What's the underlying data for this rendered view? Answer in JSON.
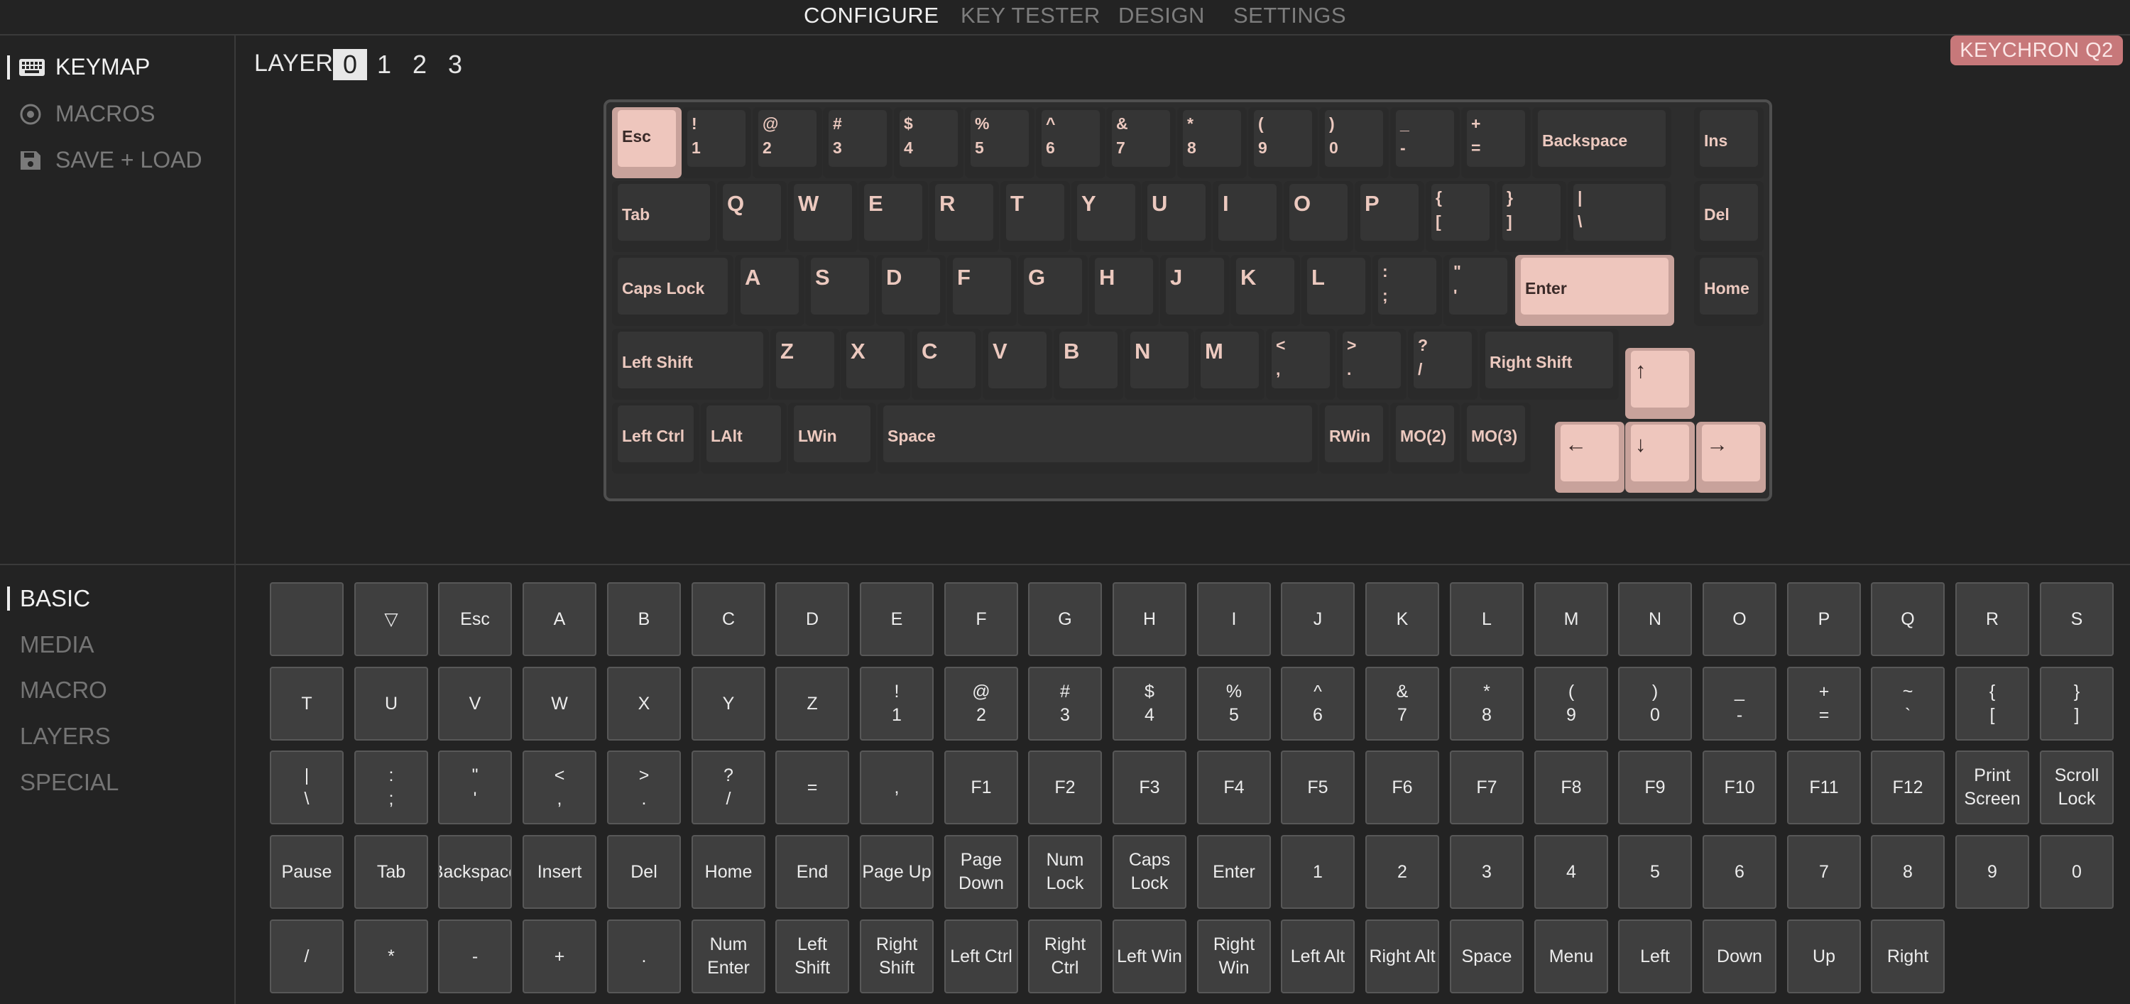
{
  "nav": {
    "tabs": [
      "CONFIGURE",
      "KEY TESTER",
      "DESIGN",
      "SETTINGS"
    ]
  },
  "sidebar": {
    "items": [
      "KEYMAP",
      "MACROS",
      "SAVE + LOAD"
    ]
  },
  "layer": {
    "label": "LAYER",
    "options": [
      "0",
      "1",
      "2",
      "3"
    ],
    "selected": "0"
  },
  "device": {
    "name": "KEYCHRON Q2"
  },
  "colors": {
    "accent": "#eec6bd",
    "badge": "#c7787a",
    "background": "#232323"
  },
  "keyboard": {
    "rows": [
      [
        {
          "main": "Esc",
          "accent": true
        },
        {
          "up": "!",
          "lo": "1"
        },
        {
          "up": "@",
          "lo": "2"
        },
        {
          "up": "#",
          "lo": "3"
        },
        {
          "up": "$",
          "lo": "4"
        },
        {
          "up": "%",
          "lo": "5"
        },
        {
          "up": "^",
          "lo": "6"
        },
        {
          "up": "&",
          "lo": "7"
        },
        {
          "up": "*",
          "lo": "8"
        },
        {
          "up": "(",
          "lo": "9"
        },
        {
          "up": ")",
          "lo": "0"
        },
        {
          "up": "_",
          "lo": "-"
        },
        {
          "up": "+",
          "lo": "="
        },
        {
          "main": "Backspace"
        },
        {
          "main": "Ins"
        }
      ],
      [
        {
          "main": "Tab"
        },
        {
          "main": "Q"
        },
        {
          "main": "W"
        },
        {
          "main": "E"
        },
        {
          "main": "R"
        },
        {
          "main": "T"
        },
        {
          "main": "Y"
        },
        {
          "main": "U"
        },
        {
          "main": "I"
        },
        {
          "main": "O"
        },
        {
          "main": "P"
        },
        {
          "up": "{",
          "lo": "["
        },
        {
          "up": "}",
          "lo": "]"
        },
        {
          "up": "|",
          "lo": "\\"
        },
        {
          "main": "Del"
        }
      ],
      [
        {
          "main": "Caps Lock"
        },
        {
          "main": "A"
        },
        {
          "main": "S"
        },
        {
          "main": "D"
        },
        {
          "main": "F"
        },
        {
          "main": "G"
        },
        {
          "main": "H"
        },
        {
          "main": "J"
        },
        {
          "main": "K"
        },
        {
          "main": "L"
        },
        {
          "up": ":",
          "lo": ";"
        },
        {
          "up": "\"",
          "lo": "'"
        },
        {
          "main": "Enter",
          "accent": true
        },
        {
          "main": "Home"
        }
      ],
      [
        {
          "main": "Left Shift"
        },
        {
          "main": "Z"
        },
        {
          "main": "X"
        },
        {
          "main": "C"
        },
        {
          "main": "V"
        },
        {
          "main": "B"
        },
        {
          "main": "N"
        },
        {
          "main": "M"
        },
        {
          "up": "<",
          "lo": ","
        },
        {
          "up": ">",
          "lo": "."
        },
        {
          "up": "?",
          "lo": "/"
        },
        {
          "main": "Right Shift"
        },
        {
          "main": "↑",
          "accent": true
        }
      ],
      [
        {
          "main": "Left Ctrl"
        },
        {
          "main": "LAlt"
        },
        {
          "main": "LWin"
        },
        {
          "main": "Space"
        },
        {
          "main": "RWin"
        },
        {
          "main": "MO(2)"
        },
        {
          "main": "MO(3)"
        },
        {
          "main": "←",
          "accent": true
        },
        {
          "main": "↓",
          "accent": true
        },
        {
          "main": "→",
          "accent": true
        }
      ]
    ]
  },
  "picker": {
    "categories": [
      "BASIC",
      "MEDIA",
      "MACRO",
      "LAYERS",
      "SPECIAL"
    ],
    "rows": [
      [
        "",
        "▽",
        "Esc",
        "A",
        "B",
        "C",
        "D",
        "E",
        "F",
        "G",
        "H",
        "I",
        "J",
        "K",
        "L",
        "M",
        "N",
        "O",
        "P",
        "Q",
        "R",
        "S"
      ],
      [
        "T",
        "U",
        "V",
        "W",
        "X",
        "Y",
        "Z",
        "!\n1",
        "@\n2",
        "#\n3",
        "$\n4",
        "%\n5",
        "^\n6",
        "&\n7",
        "*\n8",
        "(\n9",
        ")\n0",
        "_\n-",
        "+\n=",
        "~\n`",
        "{\n[",
        "}\n]"
      ],
      [
        "|\n\\",
        ":\n;",
        "\"\n'",
        "<\n,",
        ">\n.",
        "?\n/",
        "=",
        ",",
        "F1",
        "F2",
        "F3",
        "F4",
        "F5",
        "F6",
        "F7",
        "F8",
        "F9",
        "F10",
        "F11",
        "F12",
        "Print\nScreen",
        "Scroll\nLock"
      ],
      [
        "Pause",
        "Tab",
        "Backspace",
        "Insert",
        "Del",
        "Home",
        "End",
        "Page Up",
        "Page\nDown",
        "Num\nLock",
        "Caps\nLock",
        "Enter",
        "1",
        "2",
        "3",
        "4",
        "5",
        "6",
        "7",
        "8",
        "9",
        "0"
      ],
      [
        "/",
        "*",
        "-",
        "+",
        ".",
        "Num\nEnter",
        "Left\nShift",
        "Right\nShift",
        "Left Ctrl",
        "Right\nCtrl",
        "Left Win",
        "Right\nWin",
        "Left Alt",
        "Right Alt",
        "Space",
        "Menu",
        "Left",
        "Down",
        "Up",
        "Right"
      ]
    ]
  }
}
